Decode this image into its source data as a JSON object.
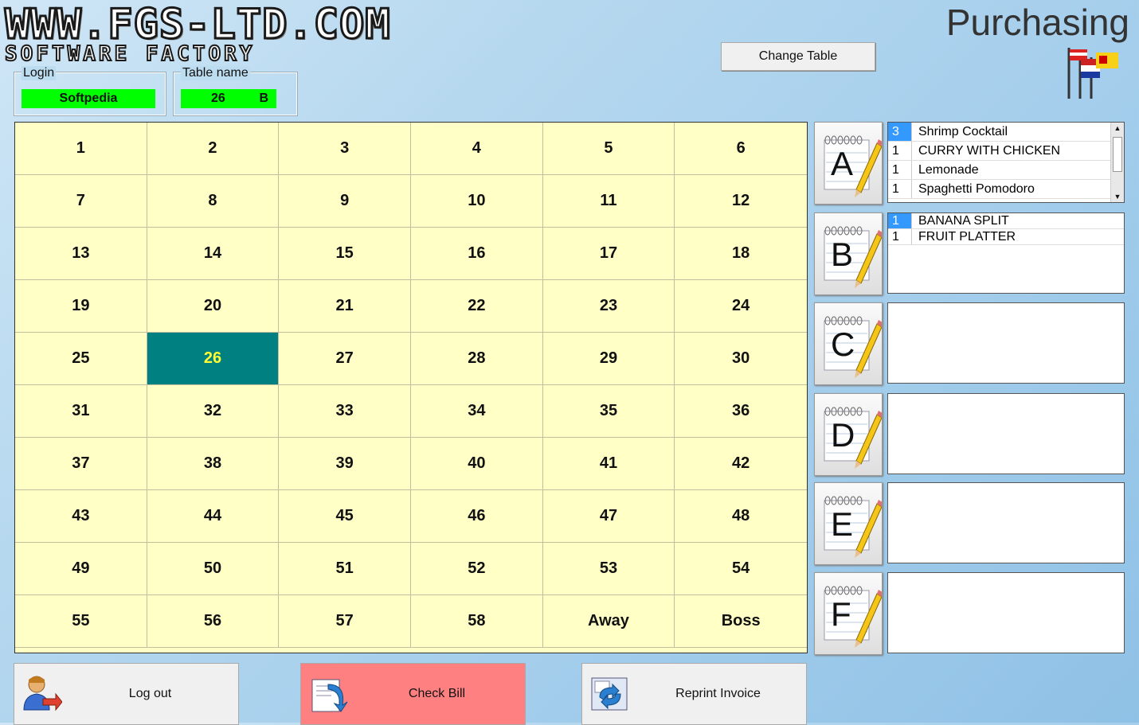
{
  "header": {
    "logo_main": "WWW.FGS-LTD.COM",
    "logo_sub": "SOFTWARE FACTORY",
    "title": "Purchasing",
    "change_table_label": "Change Table"
  },
  "login": {
    "legend": "Login",
    "value": "Softpedia"
  },
  "table_name": {
    "legend": "Table name",
    "number": "26",
    "section": "B"
  },
  "tables": [
    "1",
    "2",
    "3",
    "4",
    "5",
    "6",
    "7",
    "8",
    "9",
    "10",
    "11",
    "12",
    "13",
    "14",
    "15",
    "16",
    "17",
    "18",
    "19",
    "20",
    "21",
    "22",
    "23",
    "24",
    "25",
    "26",
    "27",
    "28",
    "29",
    "30",
    "31",
    "32",
    "33",
    "34",
    "35",
    "36",
    "37",
    "38",
    "39",
    "40",
    "41",
    "42",
    "43",
    "44",
    "45",
    "46",
    "47",
    "48",
    "49",
    "50",
    "51",
    "52",
    "53",
    "54",
    "55",
    "56",
    "57",
    "58",
    "Away",
    "Boss"
  ],
  "selected_table": "26",
  "sections": [
    {
      "letter": "A",
      "items": [
        {
          "qty": "3",
          "name": "Shrimp Cocktail",
          "highlight": true
        },
        {
          "qty": "1",
          "name": "CURRY WITH CHICKEN"
        },
        {
          "qty": "1",
          "name": "Lemonade"
        },
        {
          "qty": "1",
          "name": "Spaghetti Pomodoro"
        }
      ]
    },
    {
      "letter": "B",
      "items": [
        {
          "qty": "1",
          "name": "BANANA SPLIT",
          "highlight": true
        },
        {
          "qty": "1",
          "name": "FRUIT PLATTER"
        }
      ]
    },
    {
      "letter": "C",
      "items": []
    },
    {
      "letter": "D",
      "items": []
    },
    {
      "letter": "E",
      "items": []
    },
    {
      "letter": "F",
      "items": []
    }
  ],
  "footer": {
    "logout_label": "Log out",
    "check_bill_label": "Check Bill",
    "reprint_label": "Reprint Invoice"
  },
  "colors": {
    "selected_cell": "#008080",
    "selected_text": "#ffff33",
    "cell_bg": "#ffffc6",
    "green_field": "#00ff00",
    "check_bill_bg": "#ff8080"
  }
}
